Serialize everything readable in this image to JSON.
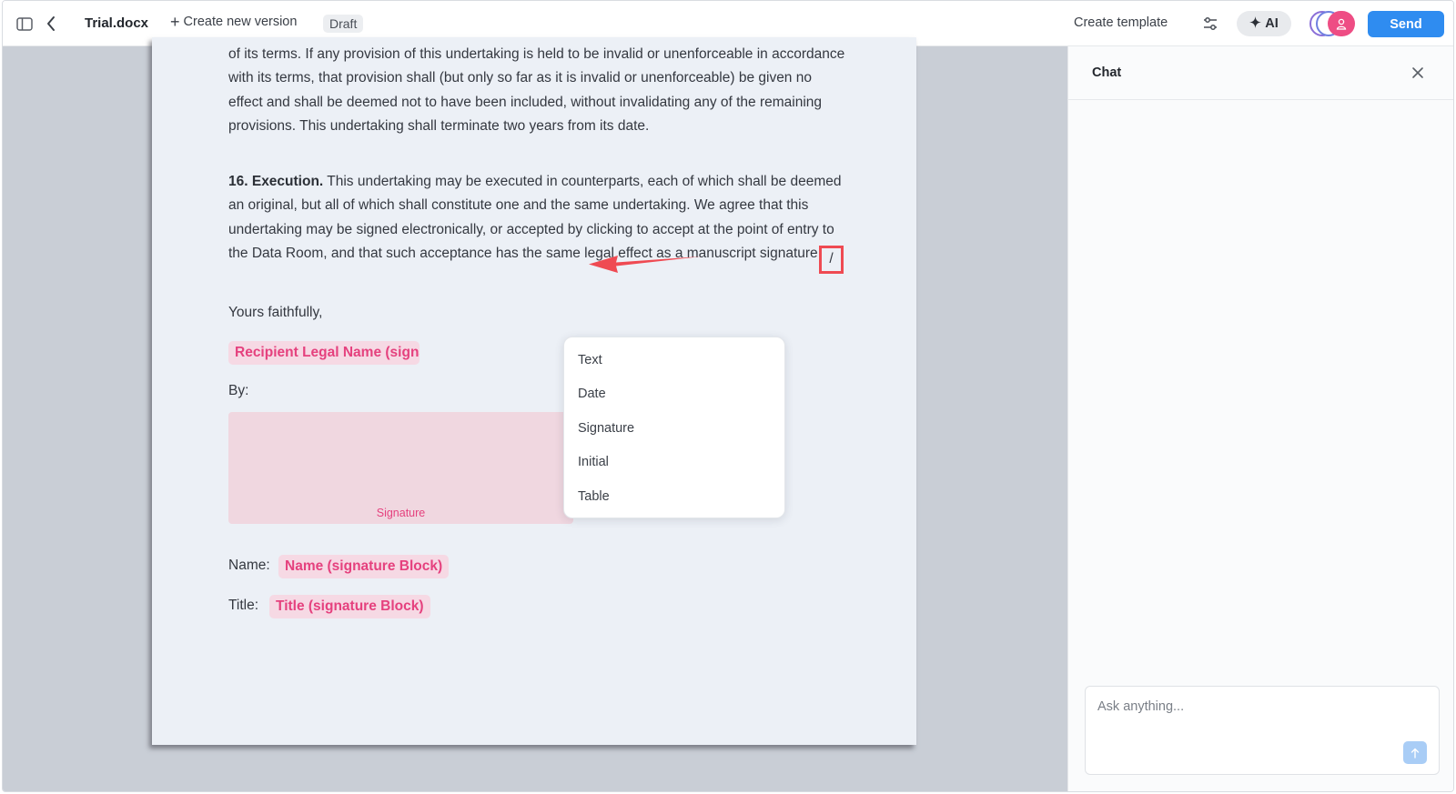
{
  "header": {
    "doc_title": "Trial.docx",
    "new_version_label": "Create new version",
    "status_badge": "Draft",
    "create_template_label": "Create template",
    "ai_label": "AI",
    "send_label": "Send"
  },
  "document": {
    "paragraph_partial": "of its terms. If any provision of this undertaking is held to be invalid or unenforceable in accordance with its terms, that provision shall (but only so far as it is invalid or unenforceable) be given no effect and shall be deemed not to have been included, without invalidating any of the remaining provisions. This undertaking shall terminate two years from its date.",
    "execution_heading": "16. Execution.",
    "execution_text": " This undertaking may be executed in counterparts, each of which shall be deemed an original, but all of which shall constitute one and the same undertaking. We agree that this undertaking may be signed electronically, or accepted by clicking to accept at the point of entry to the Data Room, and that such acceptance has the same legal effect as a manuscript signature.",
    "slash_char": "/",
    "closing": "Yours faithfully,",
    "recipient_field": "Recipient Legal Name (signature Block)",
    "by_label": "By:",
    "signature_caption": "Signature",
    "name_label": "Name:",
    "name_field": "Name (signature Block)",
    "title_label": "Title:",
    "title_field": "Title (signature Block)"
  },
  "slash_menu": {
    "items": [
      {
        "label": "Text"
      },
      {
        "label": "Date"
      },
      {
        "label": "Signature"
      },
      {
        "label": "Initial"
      },
      {
        "label": "Table"
      }
    ]
  },
  "chat": {
    "title": "Chat",
    "input_placeholder": "Ask anything..."
  },
  "icons": {
    "panel": "sidebar-toggle-icon",
    "back": "chevron-left-icon",
    "plus": "plus-icon",
    "sliders": "sliders-icon",
    "sparkle": "sparkle-icon",
    "close": "close-icon",
    "send_arrow": "arrow-up-icon"
  },
  "colors": {
    "accent": "#2f8cf0",
    "field_pink": "#e5417e",
    "field_bg": "#f6d9e4",
    "annotation_red": "#ef4a52"
  }
}
